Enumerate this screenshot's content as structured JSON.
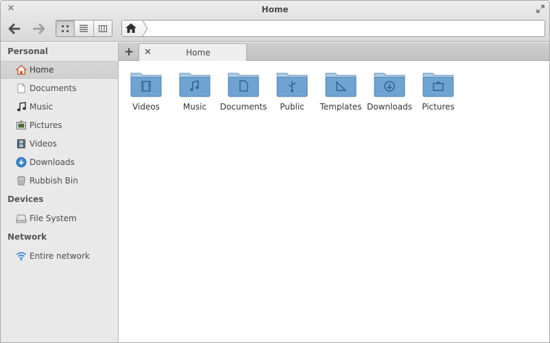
{
  "window": {
    "title": "Home"
  },
  "pathbar": {
    "current": "Home"
  },
  "sidebar": {
    "sections": {
      "personal": "Personal",
      "devices": "Devices",
      "network": "Network"
    },
    "personal_items": [
      {
        "label": "Home",
        "icon": "home-icon",
        "selected": true
      },
      {
        "label": "Documents",
        "icon": "document-icon"
      },
      {
        "label": "Music",
        "icon": "music-note-icon"
      },
      {
        "label": "Pictures",
        "icon": "pictures-icon"
      },
      {
        "label": "Videos",
        "icon": "film-icon"
      },
      {
        "label": "Downloads",
        "icon": "download-icon"
      },
      {
        "label": "Rubbish Bin",
        "icon": "trash-icon"
      }
    ],
    "device_items": [
      {
        "label": "File System",
        "icon": "drive-icon"
      }
    ],
    "network_items": [
      {
        "label": "Entire network",
        "icon": "wifi-icon"
      }
    ]
  },
  "tabs": [
    {
      "label": "Home",
      "active": true
    }
  ],
  "folders": [
    {
      "label": "Videos",
      "emblem": "film-icon"
    },
    {
      "label": "Music",
      "emblem": "music-note-icon"
    },
    {
      "label": "Documents",
      "emblem": "document-icon"
    },
    {
      "label": "Public",
      "emblem": "share-icon"
    },
    {
      "label": "Templates",
      "emblem": "set-square-icon"
    },
    {
      "label": "Downloads",
      "emblem": "download-icon"
    },
    {
      "label": "Pictures",
      "emblem": "pictures-icon"
    }
  ],
  "colors": {
    "folder_top": "#a9cbe6",
    "folder_body": "#6fa4d2",
    "accent": "#3b73b4"
  }
}
